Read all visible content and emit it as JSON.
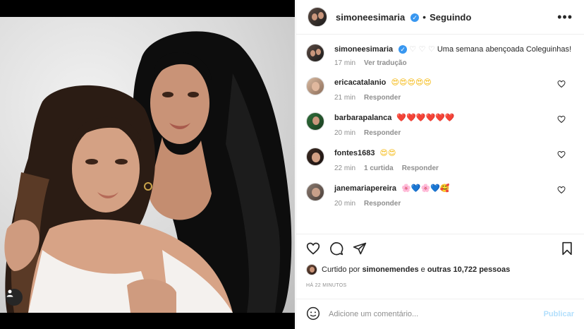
{
  "post": {
    "username": "simoneesimaria",
    "follow_state": "Seguindo",
    "more_label": "•••",
    "caption": {
      "username": "simoneesimaria",
      "hearts": "♡ ♡ ♡",
      "text": "Uma semana abençoada Coleguinhas!",
      "time": "17 min",
      "translate": "Ver tradução"
    },
    "comments": [
      {
        "username": "ericacatalanio",
        "text": "😍😍😍😍😍",
        "time": "21 min",
        "likes": "",
        "reply": "Responder",
        "emoji_class": "emo-yellow"
      },
      {
        "username": "barbarapalanca",
        "text": "❤️❤️❤️❤️❤️❤️",
        "time": "20 min",
        "likes": "",
        "reply": "Responder",
        "emoji_class": "emo-red"
      },
      {
        "username": "fontes1683",
        "text": "😍😍",
        "time": "22 min",
        "likes": "1 curtida",
        "reply": "Responder",
        "emoji_class": "emo-yellow"
      },
      {
        "username": "janemariapereira",
        "text": "🌸💙🌸💙🥰",
        "time": "20 min",
        "likes": "",
        "reply": "Responder",
        "emoji_class": "emo-pink"
      }
    ],
    "liked_by": {
      "prefix": "Curtido por",
      "user": "simonemendes",
      "connector": "e",
      "others": "outras 10,722 pessoas"
    },
    "timestamp": "HÁ 22 MINUTOS",
    "add_comment": {
      "placeholder": "Adicione um comentário...",
      "publish": "Publicar"
    }
  },
  "icons": {
    "verified": "verified-badge-icon",
    "like": "heart-icon",
    "comment": "comment-icon",
    "share": "share-icon",
    "save": "bookmark-icon",
    "emoji": "emoji-icon",
    "user_tag": "user-tag-icon"
  },
  "colors": {
    "verified": "#3897f0",
    "muted": "#8e8e8e",
    "publish_disabled": "#b2dffc"
  }
}
